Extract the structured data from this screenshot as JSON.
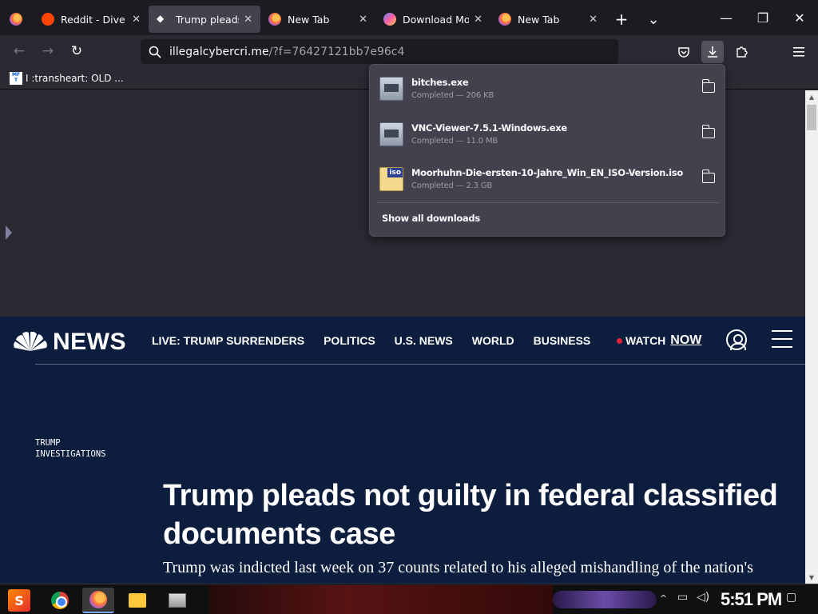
{
  "tabs": [
    {
      "title": "",
      "icon": "firefox-view-icon",
      "active": false
    },
    {
      "title": "Reddit - Dive in",
      "icon": "reddit-icon",
      "active": false
    },
    {
      "title": "Trump pleads not",
      "icon": "nbc-peacock-icon",
      "active": true
    },
    {
      "title": "New Tab",
      "icon": "firefox-icon",
      "active": false
    },
    {
      "title": "Download Moor",
      "icon": "moorhuhn-icon",
      "active": false
    },
    {
      "title": "New Tab",
      "icon": "firefox-icon",
      "active": false
    }
  ],
  "tab_close_glyph": "✕",
  "new_tab_glyph": "+",
  "list_tabs_glyph": "⌄",
  "window": {
    "minimize": "—",
    "maximize": "❐",
    "close": "✕"
  },
  "navbar": {
    "back_glyph": "←",
    "forward_glyph": "→",
    "reload_glyph": "↻",
    "url_host": "illegalcybercri.me",
    "url_path": "/?f=76427121bb7e96c4"
  },
  "bookmarks": [
    {
      "label": "I :transheart: OLD ...",
      "icon_text": "MF T"
    }
  ],
  "downloads": {
    "items": [
      {
        "name": "bitches.exe",
        "status": "Completed — 206 KB",
        "type": "exe"
      },
      {
        "name": "VNC-Viewer-7.5.1-Windows.exe",
        "status": "Completed — 11.0 MB",
        "type": "exe"
      },
      {
        "name": "Moorhuhn-Die-ersten-10-Jahre_Win_EN_ISO-Version.iso",
        "status": "Completed — 2.3 GB",
        "type": "iso"
      }
    ],
    "iso_badge": "iso",
    "show_all": "Show all downloads"
  },
  "nbc": {
    "logo_text": "NEWS",
    "nav": [
      "LIVE: TRUMP SURRENDERS",
      "POLITICS",
      "U.S. NEWS",
      "WORLD",
      "BUSINESS"
    ],
    "watch": "WATCH",
    "now": "NOW",
    "eyebrow": "TRUMP INVESTIGATIONS",
    "headline": "Trump pleads not guilty in federal classified documents case",
    "dek": "Trump was indicted last week on 37 counts related to his alleged mishandling of the nation's"
  },
  "taskbar": {
    "start_glyph": "S",
    "apps": [
      "chrome",
      "firefox",
      "file-explorer",
      "image-viewer"
    ],
    "clock": "5:51 PM"
  },
  "colors": {
    "tabbar_bg": "#1c1b22",
    "toolbar_bg": "#2b2a33",
    "nbc_bg": "#0c1d3d",
    "panel_bg": "#42414d"
  }
}
